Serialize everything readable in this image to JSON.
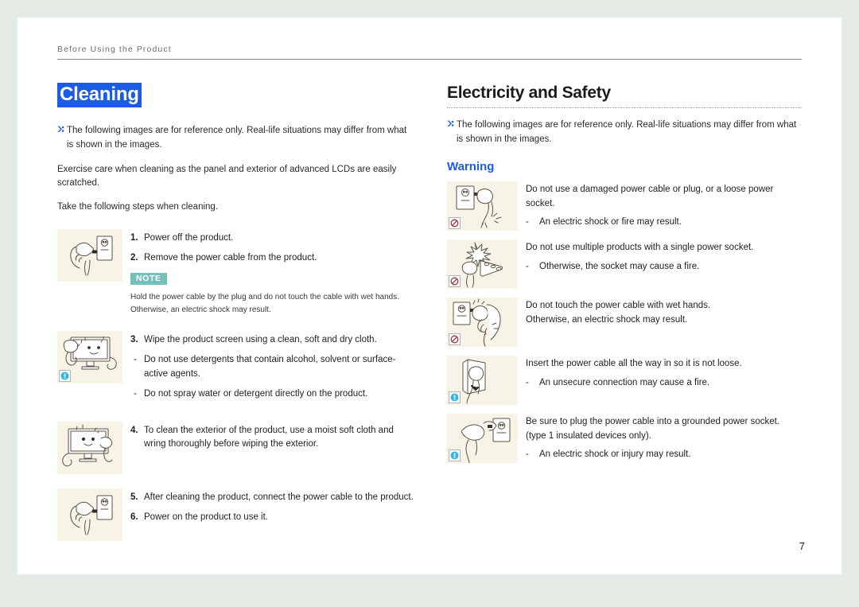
{
  "header": {
    "running_title": "Before Using the Product"
  },
  "left_column": {
    "heading": "Cleaning",
    "heading_highlighted": true,
    "notice": "The following images are for reference only. Real-life situations may differ from what is shown in the images.",
    "paragraphs": [
      "Exercise care when cleaning as the panel and exterior of advanced LCDs are easily scratched.",
      "Take the following steps when cleaning."
    ],
    "note_label": "NOTE",
    "note_lines": [
      "Hold the power cable by the plug and do not touch the cable with wet hands.",
      "Otherwise, an electric shock may result."
    ],
    "steps": [
      {
        "illustration": "hand-unplugging-cable-from-wall-socket",
        "badge": "none",
        "lines": [
          {
            "marker": "1.",
            "type": "number",
            "text": "Power off the product."
          },
          {
            "marker": "2.",
            "type": "number",
            "text": "Remove the power cable from the product."
          }
        ]
      },
      {
        "illustration": "cloth-wiping-monitor-screen-smiley",
        "badge": "info",
        "lines": [
          {
            "marker": "3.",
            "type": "number",
            "text": "Wipe the product screen using a clean, soft and dry cloth."
          },
          {
            "marker": "-",
            "type": "dash",
            "text": "Do not use detergents that contain alcohol, solvent or surface-active agents."
          },
          {
            "marker": "-",
            "type": "dash",
            "text": "Do not spray water or detergent directly on the product."
          }
        ]
      },
      {
        "illustration": "hand-wiping-monitor-exterior-smiley",
        "badge": "none",
        "lines": [
          {
            "marker": "4.",
            "type": "number",
            "text": "To clean the exterior of the product, use a moist soft cloth and wring thoroughly before wiping the exterior."
          }
        ]
      },
      {
        "illustration": "hand-plugging-cable-into-wall-socket",
        "badge": "none",
        "lines": [
          {
            "marker": "5.",
            "type": "number",
            "text": "After cleaning the product, connect the power cable to the product."
          },
          {
            "marker": "6.",
            "type": "number",
            "text": "Power on the product to use it."
          }
        ]
      }
    ]
  },
  "right_column": {
    "heading": "Electricity and Safety",
    "notice": "The following images are for reference only. Real-life situations may differ from what is shown in the images.",
    "subheading": "Warning",
    "items": [
      {
        "illustration": "damaged-plug-and-loose-socket-sparking",
        "badge": "prohibited",
        "head": "Do not use a damaged power cable or plug, or a loose power socket.",
        "sub": "An electric shock or fire may result."
      },
      {
        "illustration": "multiple-plugs-in-power-strip-sparking",
        "badge": "prohibited",
        "head": "Do not use multiple products with a single power socket.",
        "sub": "Otherwise, the socket may cause a fire."
      },
      {
        "illustration": "wet-hand-touching-power-cable-shock",
        "badge": "prohibited",
        "head": "Do not touch the power cable with wet hands.\nOtherwise, an electric shock may result.",
        "sub": ""
      },
      {
        "illustration": "plug-inserted-fully-into-socket",
        "badge": "info",
        "head": "Insert the power cable all the way in so it is not loose.",
        "sub": "An unsecure connection may cause a fire."
      },
      {
        "illustration": "plug-into-grounded-socket",
        "badge": "info",
        "head": "Be sure to plug the power cable into a grounded power socket. (type 1 insulated devices only).",
        "sub": "An electric shock or injury may result."
      }
    ]
  },
  "footer": {
    "page_number": "7"
  },
  "colors": {
    "accent_blue": "#1a5ce6",
    "note_teal": "#74c0bb",
    "illustration_bg": "#f7f4e7",
    "prohibited_red": "#a33040",
    "info_blue": "#35b3e8",
    "page_bg": "#e4ebe4"
  }
}
